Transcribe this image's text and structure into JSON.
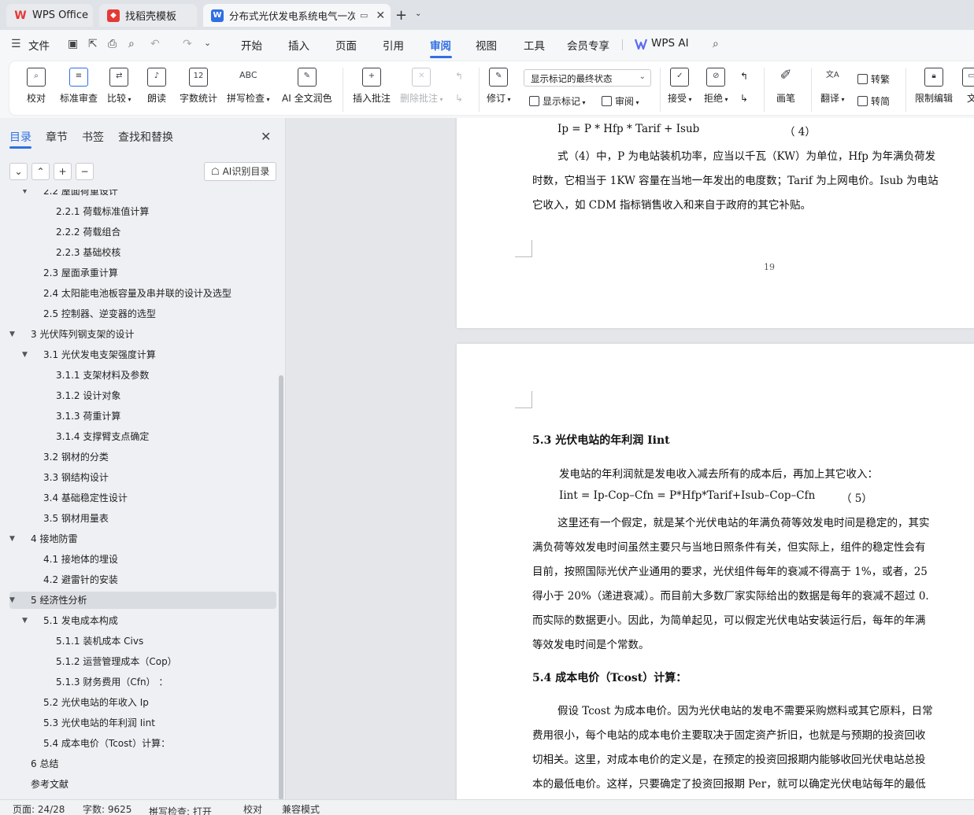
{
  "tabs": {
    "wps": "WPS Office",
    "template": "找稻壳模板",
    "doc": "分布式光伏发电系统电气一次"
  },
  "menu": {
    "file": "文件",
    "items": [
      "开始",
      "插入",
      "页面",
      "引用",
      "审阅",
      "视图",
      "工具",
      "会员专享"
    ],
    "active": "审阅",
    "wps_ai": "WPS AI"
  },
  "ribbon": {
    "proofread": "校对",
    "standard_review": "标准审查",
    "compare": "比较",
    "read_aloud": "朗读",
    "word_count": "字数统计",
    "spell_check": "拼写检查",
    "ai_proofread": "AI 全文润色",
    "insert_comment": "插入批注",
    "delete_comment": "删除批注",
    "track_changes": "修订",
    "show_markup_combo": "显示标记的最终状态",
    "show_markup": "显示标记",
    "review": "审阅",
    "accept": "接受",
    "reject": "拒绝",
    "pen": "画笔",
    "translate": "翻译",
    "to_traditional": "转繁",
    "to_simplified": "转简",
    "restrict_edit": "限制编辑",
    "doc_more": "文"
  },
  "nav": {
    "tabs": [
      "目录",
      "章节",
      "书签",
      "查找和替换"
    ],
    "ai_toc": "AI识别目录",
    "toc": [
      {
        "label": "2.2  屋面荷重设计"
      },
      {
        "label": "2.2.1  荷载标准值计算"
      },
      {
        "label": "2.2.2  荷载组合"
      },
      {
        "label": "2.2.3  基础校核"
      },
      {
        "label": "2.3  屋面承重计算"
      },
      {
        "label": "2.4  太阳能电池板容量及串并联的设计及选型"
      },
      {
        "label": "2.5  控制器、逆变器的选型"
      },
      {
        "label": "3  光伏阵列钢支架的设计"
      },
      {
        "label": "3.1 光伏发电支架强度计算"
      },
      {
        "label": "3.1.1  支架材料及参数"
      },
      {
        "label": "3.1.2  设计对象"
      },
      {
        "label": "3.1.3  荷重计算"
      },
      {
        "label": "3.1.4  支撑臂支点确定"
      },
      {
        "label": "3.2  钢材的分类"
      },
      {
        "label": "3.3  钢结构设计"
      },
      {
        "label": "3.4  基础稳定性设计"
      },
      {
        "label": "3.5  钢材用量表"
      },
      {
        "label": "4  接地防雷"
      },
      {
        "label": "4.1  接地体的埋设"
      },
      {
        "label": "4.2  避雷针的安装"
      },
      {
        "label": "5  经济性分析"
      },
      {
        "label": "5.1 发电成本构成"
      },
      {
        "label": "5.1.1 装机成本 Civs"
      },
      {
        "label": "5.1.2  运营管理成本（Cop）"
      },
      {
        "label": "5.1.3  财务费用（Cfn）  ："
      },
      {
        "label": "5.2  光伏电站的年收入 Ip"
      },
      {
        "label": "5.3  光伏电站的年利润 Iint"
      },
      {
        "label": "5.4  成本电价（Tcost）计算："
      },
      {
        "label": "6  总结"
      },
      {
        "label": "参考文献"
      }
    ]
  },
  "doc": {
    "page1": {
      "formula4": "Ip = P * Hfp * Tarif + Isub",
      "formula4_num": "（ 4）",
      "line1": "式（4）中，P 为电站装机功率，应当以千瓦（KW）为单位，Hfp 为年满负荷发",
      "line2": "时数，它相当于 1KW 容量在当地一年发出的电度数；Tarif 为上网电价。Isub 为电站",
      "line3": "它收入，如 CDM 指标销售收入和来自于政府的其它补贴。",
      "page_number": "19"
    },
    "page2": {
      "heading53": "5.3  光伏电站的年利润 Iint",
      "intro": "发电站的年利润就是发电收入减去所有的成本后，再加上其它收入：",
      "formula5": "Iint = Ip-Cop–Cfn     = P*Hfp*Tarif+Isub–Cop–Cfn",
      "formula5_num": "（ 5）",
      "para1": [
        "这里还有一个假定，就是某个光伏电站的年满负荷等效发电时间是稳定的，其实",
        "满负荷等效发电时间虽然主要只与当地日照条件有关，但实际上，组件的稳定性会有",
        "目前，按照国际光伏产业通用的要求，光伏组件每年的衰减不得高于 1%，或者，25",
        "得小于 20%（递进衰减）。而目前大多数厂家实际给出的数据是每年的衰减不超过 0.",
        "而实际的数据更小。因此，为简单起见，可以假定光伏电站安装运行后，每年的年满",
        "等效发电时间是个常数。"
      ],
      "heading54": "5.4  成本电价（Tcost）计算：",
      "para2": [
        "假设 Tcost 为成本电价。因为光伏电站的发电不需要采购燃料或其它原料，日常",
        "费用很小，每个电站的成本电价主要取决于固定资产折旧，也就是与预期的投资回收",
        "切相关。这里，对成本电价的定义是，在预定的投资回报期内能够收回光伏电站总投",
        "本的最低电价。这样，只要确定了投资回报期 Per，就可以确定光伏电站每年的最低"
      ]
    }
  },
  "status": {
    "page": "页面: 24/28",
    "words": "字数: 9625",
    "spell": "拼写检查: 打开",
    "proof": "校对",
    "compat": "兼容模式"
  }
}
